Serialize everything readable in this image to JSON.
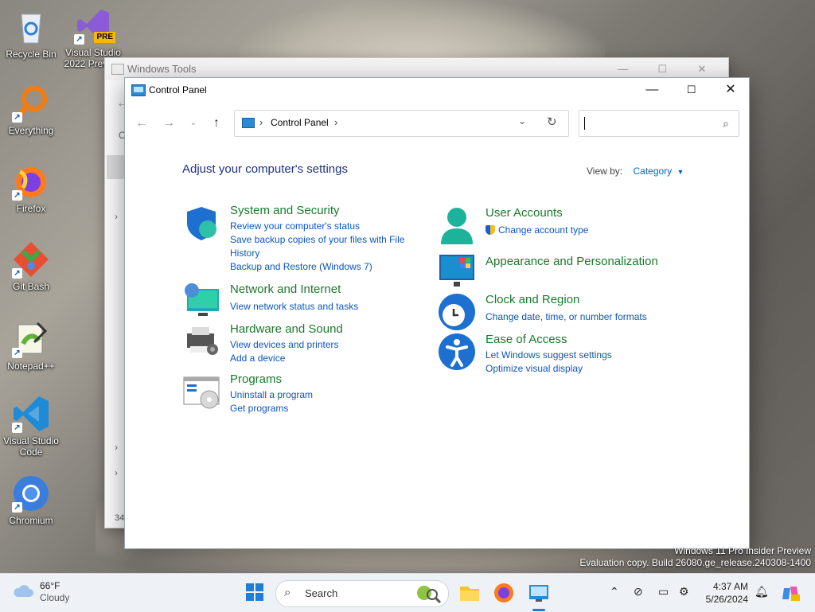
{
  "desktop": {
    "icons": [
      {
        "label": "Recycle Bin"
      },
      {
        "label": "Visual Studio 2022 Preview",
        "badge": "PRE"
      },
      {
        "label": "Everything"
      },
      {
        "label": "Firefox"
      },
      {
        "label": "Git Bash"
      },
      {
        "label": "Notepad++"
      },
      {
        "label": "Visual Studio Code"
      },
      {
        "label": "Chromium"
      }
    ]
  },
  "back_window": {
    "title": "Windows Tools",
    "side_letter": "O",
    "footer_num": "34"
  },
  "control_panel": {
    "title": "Control Panel",
    "address": {
      "crumb": "Control Panel"
    },
    "search": {
      "placeholder": ""
    },
    "heading": "Adjust your computer's settings",
    "view_by": {
      "label": "View by:",
      "value": "Category"
    },
    "categories": {
      "system_security": {
        "title": "System and Security",
        "links": [
          "Review your computer's status",
          "Save backup copies of your files with File History",
          "Backup and Restore (Windows 7)"
        ]
      },
      "network": {
        "title": "Network and Internet",
        "links": [
          "View network status and tasks"
        ]
      },
      "hardware": {
        "title": "Hardware and Sound",
        "links": [
          "View devices and printers",
          "Add a device"
        ]
      },
      "programs": {
        "title": "Programs",
        "links": [
          "Uninstall a program",
          "Get programs"
        ]
      },
      "user_accounts": {
        "title": "User Accounts",
        "links": [
          "Change account type"
        ]
      },
      "appearance": {
        "title": "Appearance and Personalization",
        "links": []
      },
      "clock": {
        "title": "Clock and Region",
        "links": [
          "Change date, time, or number formats"
        ]
      },
      "ease": {
        "title": "Ease of Access",
        "links": [
          "Let Windows suggest settings",
          "Optimize visual display"
        ]
      }
    }
  },
  "watermark": {
    "line1": "Windows 11 Pro Insider Preview",
    "line2": "Evaluation copy. Build 26080.ge_release.240308-1400"
  },
  "taskbar": {
    "weather": {
      "temp": "66°F",
      "condition": "Cloudy"
    },
    "search_placeholder": "Search",
    "time": "4:37 AM",
    "date": "5/26/2024"
  },
  "colors": {
    "link": "#0b55c4",
    "category_title": "#1a7a2c",
    "heading": "#1e3287"
  }
}
